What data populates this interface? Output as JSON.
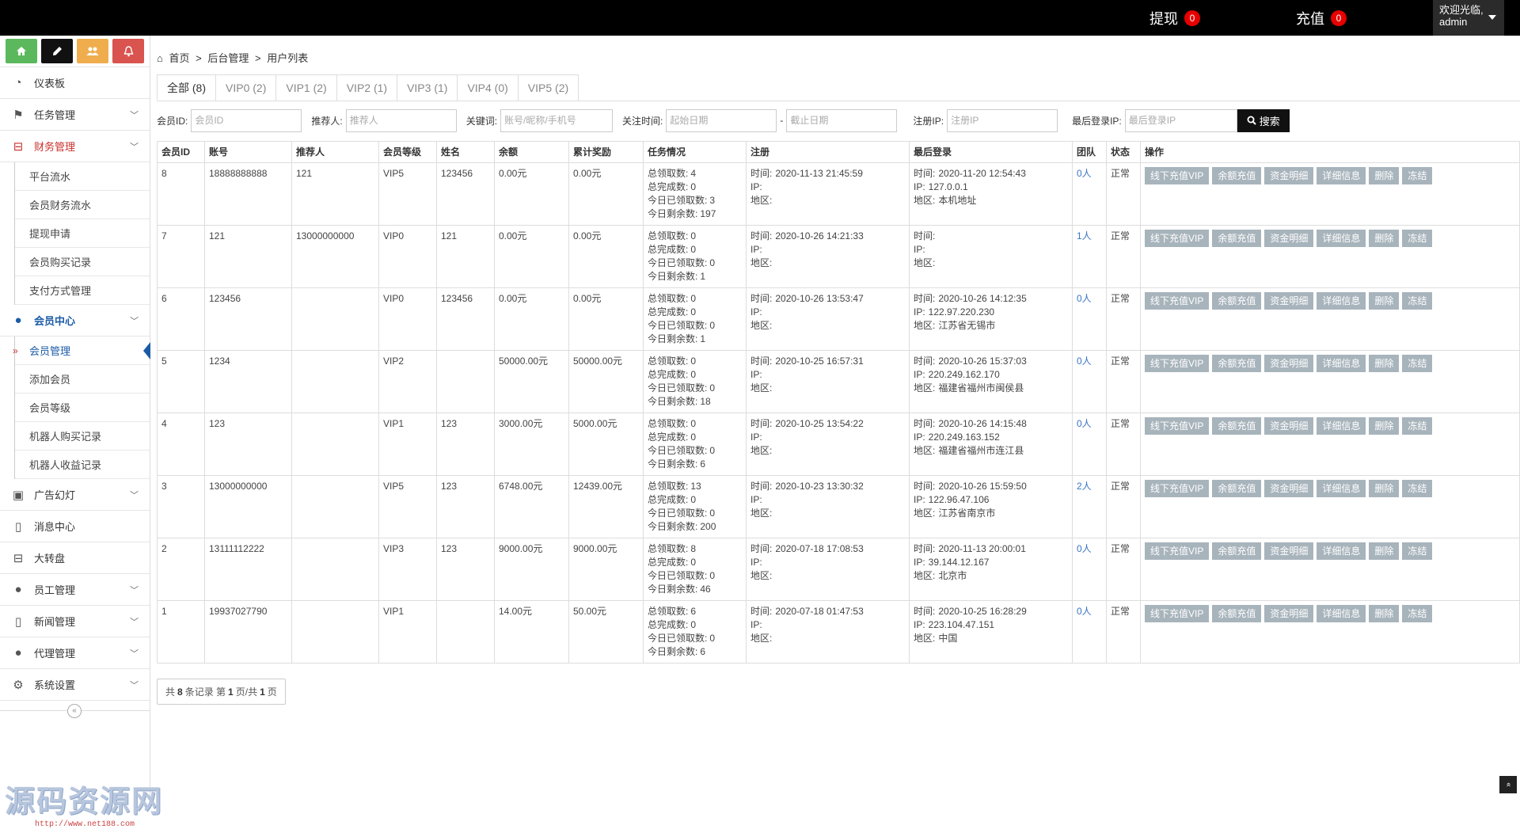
{
  "topbar": {
    "withdraw_label": "提现",
    "withdraw_count": "0",
    "recharge_label": "充值",
    "recharge_count": "0",
    "welcome": "欢迎光临,",
    "username": "admin"
  },
  "sidebar": {
    "shortcut_colors": [
      "#5cb85c",
      "#111111",
      "#f0ad4e",
      "#d9534f"
    ],
    "nav": {
      "dashboard": "仪表板",
      "tasks": "任务管理",
      "finance": "财务管理",
      "finance_sub": [
        "平台流水",
        "会员财务流水",
        "提现申请",
        "会员购买记录",
        "支付方式管理"
      ],
      "members": "会员中心",
      "members_sub": [
        "会员管理",
        "添加会员",
        "会员等级",
        "机器人购买记录",
        "机器人收益记录"
      ],
      "ads": "广告幻灯",
      "messages": "消息中心",
      "wheel": "大转盘",
      "staff": "员工管理",
      "news": "新闻管理",
      "agents": "代理管理",
      "settings": "系统设置"
    },
    "collapse_symbol": "«",
    "watermark_big": "源码资源网",
    "watermark_small": "http://www.net188.com"
  },
  "breadcrumb": {
    "home": "首页",
    "sep": ">",
    "backend": "后台管理",
    "current": "用户列表"
  },
  "tabs": [
    "全部 (8)",
    "VIP0 (2)",
    "VIP1 (2)",
    "VIP2 (1)",
    "VIP3 (1)",
    "VIP4 (0)",
    "VIP5 (2)"
  ],
  "filters": {
    "member_id_label": "会员ID:",
    "member_id_placeholder": "会员ID",
    "referrer_label": "推荐人:",
    "referrer_placeholder": "推荐人",
    "keyword_label": "关键词:",
    "keyword_placeholder": "账号/昵称/手机号",
    "follow_time_label": "关注时间:",
    "start_placeholder": "起始日期",
    "date_sep": "-",
    "end_placeholder": "截止日期",
    "reg_ip_label": "注册IP:",
    "reg_ip_placeholder": "注册IP",
    "last_ip_label": "最后登录IP:",
    "last_ip_placeholder": "最后登录IP",
    "search_label": "搜索"
  },
  "table": {
    "headers": [
      "会员ID",
      "账号",
      "推荐人",
      "会员等级",
      "姓名",
      "余额",
      "累计奖励",
      "任务情况",
      "注册",
      "最后登录",
      "团队",
      "状态",
      "操作"
    ],
    "task_labels": [
      "总领取数:",
      "总完成数:",
      "今日已领取数:",
      "今日剩余数:"
    ],
    "reg_labels": [
      "时间:",
      "IP:",
      "地区:"
    ],
    "login_labels": [
      "时间:",
      "IP:",
      "地区:"
    ],
    "actions": [
      "线下充值VIP",
      "余额充值",
      "资金明细",
      "详细信息",
      "删除",
      "冻结"
    ],
    "rows": [
      {
        "id": "8",
        "account": "18888888888",
        "referrer": "121",
        "level": "VIP5",
        "name": "123456",
        "balance": "0.00元",
        "reward": "0.00元",
        "task": [
          "4",
          "0",
          "3",
          "197"
        ],
        "reg_time": "2020-11-13 21:45:59",
        "reg_ip": "",
        "reg_area": "",
        "login_time": "2020-11-20 12:54:43",
        "login_ip": "127.0.0.1",
        "login_area": "本机地址",
        "team": "0人",
        "status": "正常"
      },
      {
        "id": "7",
        "account": "121",
        "referrer": "13000000000",
        "level": "VIP0",
        "name": "121",
        "balance": "0.00元",
        "reward": "0.00元",
        "task": [
          "0",
          "0",
          "0",
          "1"
        ],
        "reg_time": "2020-10-26 14:21:33",
        "reg_ip": "",
        "reg_area": "",
        "login_time": "",
        "login_ip": "",
        "login_area": "",
        "team": "1人",
        "status": "正常"
      },
      {
        "id": "6",
        "account": "123456",
        "referrer": "",
        "level": "VIP0",
        "name": "123456",
        "balance": "0.00元",
        "reward": "0.00元",
        "task": [
          "0",
          "0",
          "0",
          "1"
        ],
        "reg_time": "2020-10-26 13:53:47",
        "reg_ip": "",
        "reg_area": "",
        "login_time": "2020-10-26 14:12:35",
        "login_ip": "122.97.220.230",
        "login_area": "江苏省无锡市",
        "team": "0人",
        "status": "正常"
      },
      {
        "id": "5",
        "account": "1234",
        "referrer": "",
        "level": "VIP2",
        "name": "",
        "balance": "50000.00元",
        "reward": "50000.00元",
        "task": [
          "0",
          "0",
          "0",
          "18"
        ],
        "reg_time": "2020-10-25 16:57:31",
        "reg_ip": "",
        "reg_area": "",
        "login_time": "2020-10-26 15:37:03",
        "login_ip": "220.249.162.170",
        "login_area": "福建省福州市闽侯县",
        "team": "0人",
        "status": "正常"
      },
      {
        "id": "4",
        "account": "123",
        "referrer": "",
        "level": "VIP1",
        "name": "123",
        "balance": "3000.00元",
        "reward": "5000.00元",
        "task": [
          "0",
          "0",
          "0",
          "6"
        ],
        "reg_time": "2020-10-25 13:54:22",
        "reg_ip": "",
        "reg_area": "",
        "login_time": "2020-10-26 14:15:48",
        "login_ip": "220.249.163.152",
        "login_area": "福建省福州市连江县",
        "team": "0人",
        "status": "正常"
      },
      {
        "id": "3",
        "account": "13000000000",
        "referrer": "",
        "level": "VIP5",
        "name": "123",
        "balance": "6748.00元",
        "reward": "12439.00元",
        "task": [
          "13",
          "0",
          "0",
          "200"
        ],
        "reg_time": "2020-10-23 13:30:32",
        "reg_ip": "",
        "reg_area": "",
        "login_time": "2020-10-26 15:59:50",
        "login_ip": "122.96.47.106",
        "login_area": "江苏省南京市",
        "team": "2人",
        "status": "正常"
      },
      {
        "id": "2",
        "account": "13111112222",
        "referrer": "",
        "level": "VIP3",
        "name": "123",
        "balance": "9000.00元",
        "reward": "9000.00元",
        "task": [
          "8",
          "0",
          "0",
          "46"
        ],
        "reg_time": "2020-07-18 17:08:53",
        "reg_ip": "",
        "reg_area": "",
        "login_time": "2020-11-13 20:00:01",
        "login_ip": "39.144.12.167",
        "login_area": "北京市",
        "team": "0人",
        "status": "正常"
      },
      {
        "id": "1",
        "account": "19937027790",
        "referrer": "",
        "level": "VIP1",
        "name": "",
        "balance": "14.00元",
        "reward": "50.00元",
        "task": [
          "6",
          "0",
          "0",
          "6"
        ],
        "reg_time": "2020-07-18 01:47:53",
        "reg_ip": "",
        "reg_area": "",
        "login_time": "2020-10-25 16:28:29",
        "login_ip": "223.104.47.151",
        "login_area": "中国",
        "team": "0人",
        "status": "正常"
      }
    ]
  },
  "pager": {
    "prefix": "共",
    "total": "8",
    "mid1": "条记录 第",
    "page": "1",
    "mid2": "页/共",
    "pages": "1",
    "suffix": "页"
  },
  "scroll_top_symbol": "«"
}
